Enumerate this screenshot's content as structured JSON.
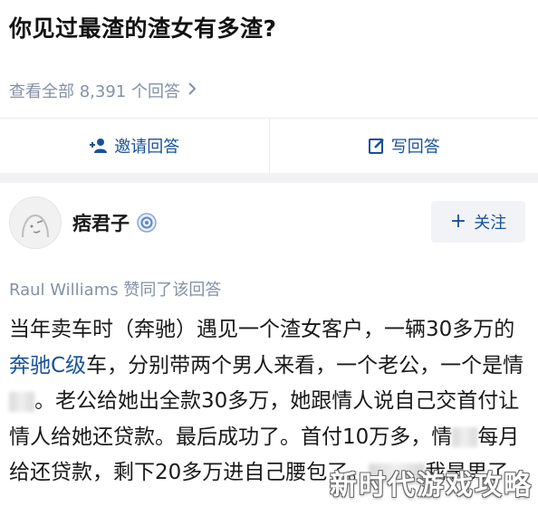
{
  "question": {
    "title": "你见过最渣的渣女有多渣?",
    "view_all": "查看全部 8,391 个回答",
    "view_all_chevron": "chevron-right-icon"
  },
  "actions": {
    "invite": {
      "label": "邀请回答",
      "icon": "invite-user-icon"
    },
    "write": {
      "label": "写回答",
      "icon": "edit-icon"
    }
  },
  "author": {
    "name": "痞君子",
    "badge_icon": "verified-badge-icon",
    "avatar_icon": "avatar-icon",
    "follow_label": "关注",
    "follow_icon": "plus-icon"
  },
  "upvote_text": "Raul Williams 赞同了该回答",
  "answer": {
    "seg1": "当年卖车时（奔驰）遇见一个渣女客户，一辆30多万的",
    "link": "奔驰C级",
    "seg2": "车，分别带两个男人来看，一个老公，一个是情",
    "seg3": "。老公给她出全款30多万，她跟情人说自己交首付让情人给她还贷款。最后成功了。首付10万多，情",
    "seg4": "每月给还贷款，剩下20多万进自己腰包了。",
    "seg5": "我是男了"
  },
  "watermark": "新时代游戏攻略",
  "colors": {
    "link_blue": "#175199",
    "muted_gray": "#8590a6",
    "section_bg": "#f2f2f4"
  }
}
